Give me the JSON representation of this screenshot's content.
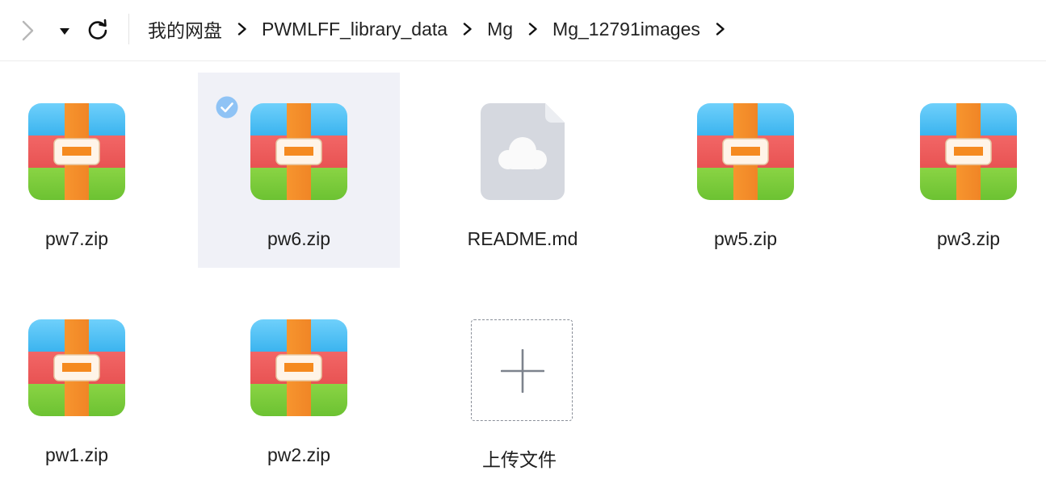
{
  "toolbar": {
    "back_icon": "chevron-right-icon",
    "dropdown_icon": "caret-down-icon",
    "refresh_icon": "refresh-icon"
  },
  "breadcrumb": [
    {
      "label": "我的网盘"
    },
    {
      "label": "PWMLFF_library_data"
    },
    {
      "label": "Mg"
    },
    {
      "label": "Mg_12791images"
    }
  ],
  "files": [
    {
      "name": "pw7.zip",
      "type": "zip",
      "selected": false
    },
    {
      "name": "pw6.zip",
      "type": "zip",
      "selected": true
    },
    {
      "name": "README.md",
      "type": "cloud-doc",
      "selected": false
    },
    {
      "name": "pw5.zip",
      "type": "zip",
      "selected": false
    },
    {
      "name": "pw3.zip",
      "type": "zip",
      "selected": false
    },
    {
      "name": "pw1.zip",
      "type": "zip",
      "selected": false
    },
    {
      "name": "pw2.zip",
      "type": "zip",
      "selected": false
    }
  ],
  "upload": {
    "label": "上传文件",
    "icon": "plus-icon"
  },
  "colors": {
    "zip_blue": "#4fc3f7",
    "zip_red": "#ef5b5b",
    "zip_green": "#7ccc3c",
    "zip_strap": "#f58f2a",
    "selected_bg": "#f0f1f7",
    "check": "#8fc3f5",
    "doc_gray": "#d9dce3"
  }
}
